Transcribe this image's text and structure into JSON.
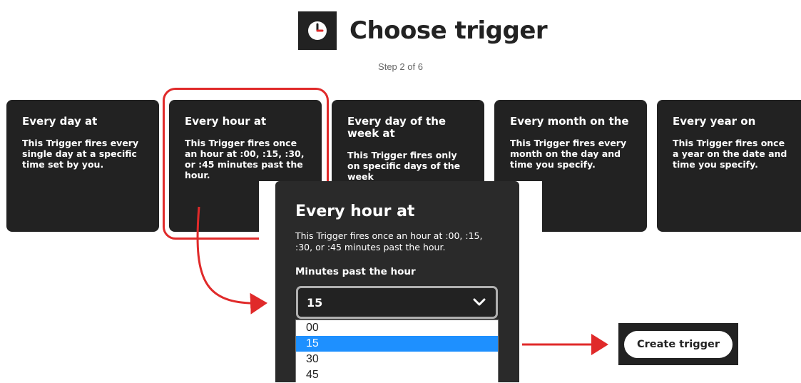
{
  "header": {
    "title": "Choose trigger",
    "step": "Step 2 of 6",
    "icon": "clock-icon"
  },
  "cards": [
    {
      "title": "Every day at",
      "desc": "This Trigger fires every single day at a specific time set by you."
    },
    {
      "title": "Every hour at",
      "desc": "This Trigger fires once an hour at :00, :15, :30, or :45 minutes past the hour."
    },
    {
      "title": "Every day of the week at",
      "desc": "This Trigger fires only on specific days of the week"
    },
    {
      "title": "Every month on the",
      "desc": "This Trigger fires every month on the day and time you specify."
    },
    {
      "title": "Every year on",
      "desc": "This Trigger fires once a year on the date and time you specify."
    }
  ],
  "panel": {
    "title": "Every hour at",
    "desc": "This Trigger fires once an hour at :00, :15, :30, or :45 minutes past the hour.",
    "field_label": "Minutes past the hour",
    "selected": "15",
    "options": [
      "00",
      "15",
      "30",
      "45"
    ]
  },
  "button": {
    "label": "Create trigger"
  },
  "colors": {
    "accent_red": "#e02a2a",
    "selected_blue": "#1e90ff",
    "card_bg": "#222222"
  }
}
